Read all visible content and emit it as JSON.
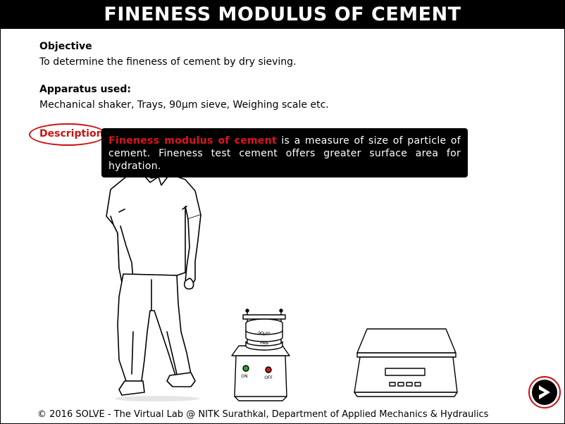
{
  "header": {
    "title": "FINENESS MODULUS OF CEMENT"
  },
  "objective": {
    "heading": "Objective",
    "text": "To determine the fineness of cement by dry sieving."
  },
  "apparatus": {
    "heading": "Apparatus used:",
    "text": "Mechanical shaker, Trays, 90µm sieve, Weighing scale etc."
  },
  "description": {
    "link_label": "Description",
    "tooltip_highlight": "Fineness modulus of cement",
    "tooltip_text": " is a measure of size of particle of cement. Fineness test cement offers greater surface area for hydration."
  },
  "illustration": {
    "sieve_label": "90µm",
    "pan_label": "PAN",
    "on_label": "ON",
    "off_label": "OFF"
  },
  "footer": {
    "text": "© 2016 SOLVE - The Virtual Lab @ NITK Surathkal, Department of Applied Mechanics & Hydraulics"
  },
  "colors": {
    "accent": "#cc1111",
    "highlight": "#e0141e",
    "header_bg": "#000000"
  },
  "icons": {
    "next": "next-arrow-icon"
  }
}
